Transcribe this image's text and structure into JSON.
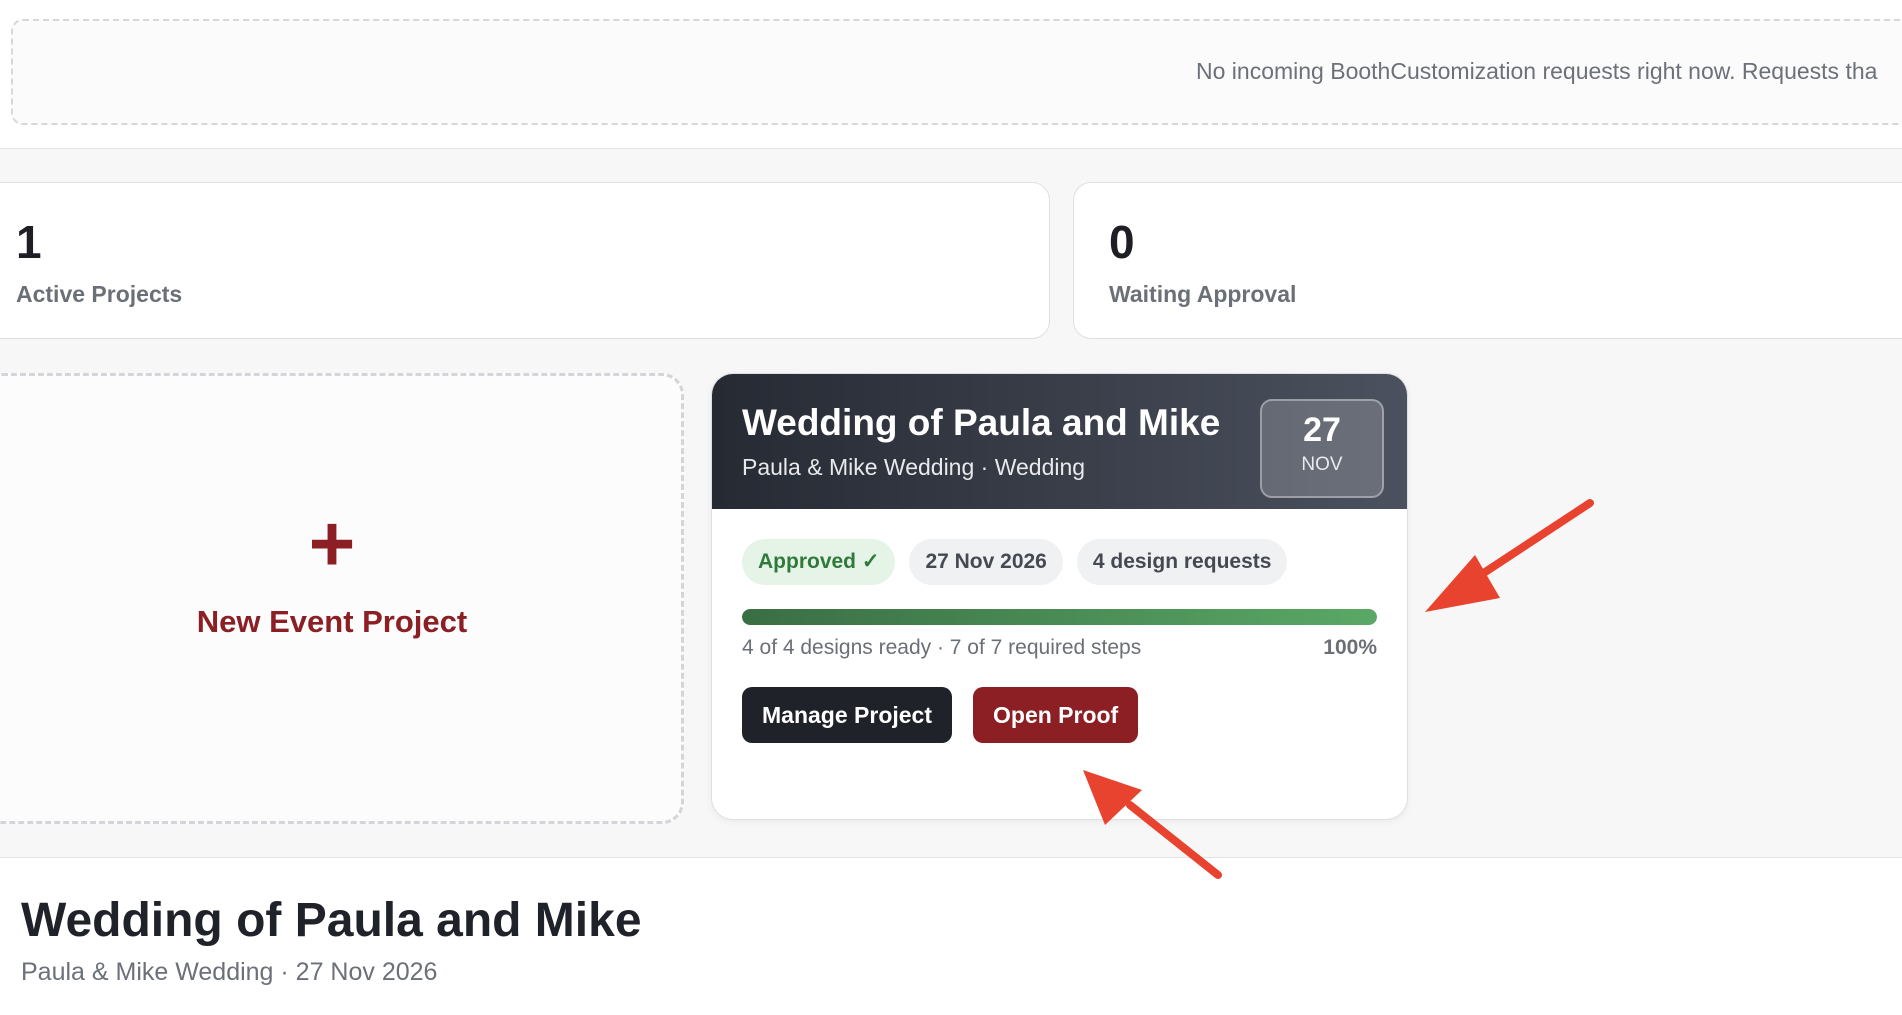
{
  "banner": {
    "text": "No incoming BoothCustomization requests right now. Requests tha"
  },
  "stats": [
    {
      "value": "1",
      "label": "Active Projects"
    },
    {
      "value": "0",
      "label": "Waiting Approval"
    }
  ],
  "new_project": {
    "icon": "plus-icon",
    "plus": "+",
    "label": "New Event Project"
  },
  "project": {
    "title": "Wedding of Paula and Mike",
    "subtitle": "Paula & Mike Wedding · Wedding",
    "date_day": "27",
    "date_month": "NOV",
    "chips": [
      "Approved ✓",
      "27 Nov 2026",
      "4 design requests"
    ],
    "progress_percent": 100,
    "progress_text": "4 of 4 designs ready · 7 of 7 required steps",
    "progress_label": "100%",
    "manage_label": "Manage Project",
    "proof_label": "Open Proof"
  },
  "detail": {
    "title": "Wedding of Paula and Mike",
    "subtitle": "Paula & Mike Wedding · 27 Nov 2026"
  },
  "colors": {
    "accent": "#8b1f24",
    "dark": "#1f2229",
    "success": "#2f7a3a",
    "annotation": "#e8432e"
  }
}
